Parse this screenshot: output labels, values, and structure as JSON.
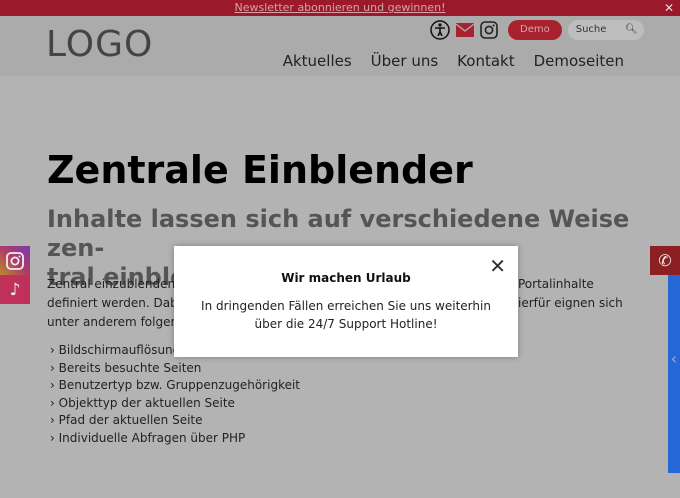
{
  "topbar": {
    "newsletter_link": "Newsletter abonnieren und gewinnen!",
    "close": "✕"
  },
  "header": {
    "logo": "LOGO",
    "demo_label": "Demo",
    "search_placeholder": "Suche",
    "nav": [
      "Aktuelles",
      "Über uns",
      "Kontakt",
      "Demoseiten"
    ]
  },
  "main": {
    "title": "Zentrale Einblender",
    "subtitle": "Inhalte lassen sich auf verschiedene Weise zen-tral einblenden",
    "subtitle_line1": "Inhalte lassen sich auf verschiedene Weise zen-",
    "subtitle_line2": "tral einble",
    "para_left": [
      "Zentral einzublendende",
      "definiert werden. Dabe",
      "unter anderem folgend"
    ],
    "para_right": [
      "Portalinhalte",
      "ierfür eignen sich"
    ],
    "list": [
      "Bildschirmauflösung",
      "Bereits besuchte Seiten",
      "Benutzertyp bzw. Gruppenzugehörigkeit",
      "Objekttyp der aktuellen Seite",
      "Pfad der aktuellen Seite",
      "Individuelle Abfragen über PHP"
    ]
  },
  "modal": {
    "title": "Wir machen Urlaub",
    "body": "In dringenden Fällen erreichen Sie uns weiterhin über die 24/7 Support Hotline!"
  },
  "colors": {
    "brand_red": "#9a1a2b",
    "blue_bar": "#2567d6"
  }
}
